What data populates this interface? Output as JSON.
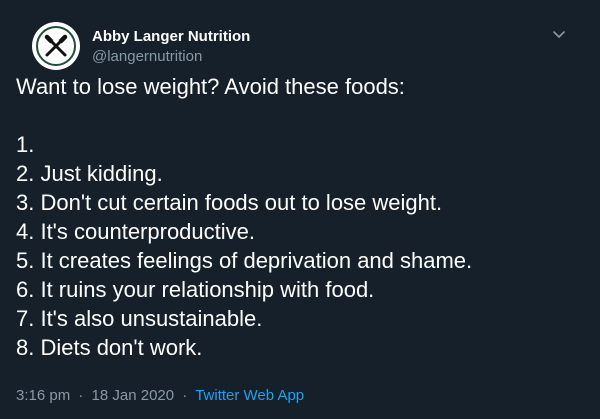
{
  "author": {
    "display_name": "Abby Langer Nutrition",
    "handle": "@langernutrition",
    "avatar_icon": "crossed-fork-knife-logo"
  },
  "tweet": {
    "lines": [
      "Want to lose weight? Avoid these foods:",
      "",
      "1.",
      "2. Just kidding.",
      "3. Don't cut certain foods out to lose weight.",
      "4. It's counterproductive.",
      "5. It creates feelings of deprivation and shame.",
      "6. It ruins your relationship with food.",
      "7. It's also unsustainable.",
      "8. Diets don't work."
    ],
    "time": "3:16 pm",
    "separator": "·",
    "date": "18 Jan 2020",
    "source": "Twitter Web App"
  },
  "colors": {
    "background": "#15202b",
    "primary_text": "#ffffff",
    "secondary_text": "#8899a6",
    "link": "#1da1f2"
  },
  "icons": {
    "menu": "chevron-down-icon"
  }
}
